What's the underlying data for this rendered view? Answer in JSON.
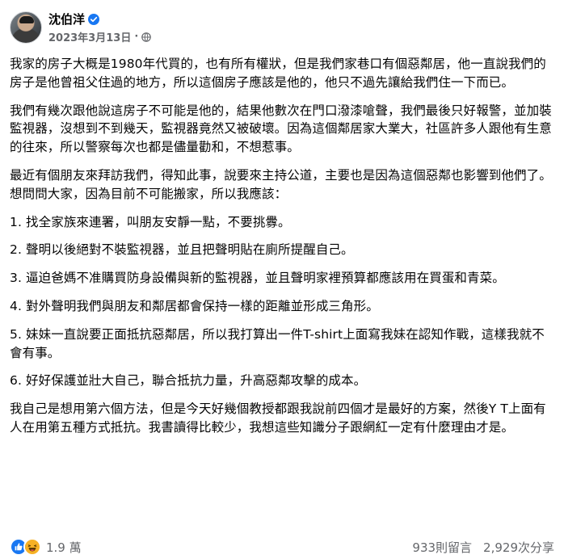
{
  "post": {
    "author": "沈伯洋",
    "date": "2023年3月13日",
    "separator": "·",
    "visibility_icon": "globe-icon",
    "verified_icon": "verified-badge-icon",
    "accent_color": "#1877f2",
    "paragraphs": [
      "我家的房子大概是1980年代買的，也有所有權狀，但是我們家巷口有個惡鄰居，他一直說我們的房子是他曾祖父住過的地方，所以這個房子應該是他的，他只不過先讓給我們住一下而已。",
      "我們有幾次跟他說這房子不可能是他的，結果他數次在門口潑漆嗆聲，我們最後只好報警，並加裝監視器，沒想到不到幾天，監視器竟然又被破壞。因為這個鄰居家大業大，社區許多人跟他有生意的往來，所以警察每次也都是儘量勸和，不想惹事。",
      "最近有個朋友來拜訪我們，得知此事，說要來主持公道，主要也是因為這個惡鄰也影響到他們了。想問問大家，因為目前不可能搬家，所以我應該：",
      "1. 找全家族來連署，叫朋友安靜一點，不要挑釁。",
      "2. 聲明以後絕對不裝監視器，並且把聲明貼在廁所提醒自己。",
      "3. 逼迫爸媽不准購買防身設備與新的監視器，並且聲明家裡預算都應該用在買蛋和青菜。",
      "4. 對外聲明我們與朋友和鄰居都會保持一樣的距離並形成三角形。",
      "5. 妹妹一直說要正面抵抗惡鄰居，所以我打算出一件T-shirt上面寫我妹在認知作戰，這樣我就不會有事。",
      "6. 好好保護並壯大自己，聯合抵抗力量，升高惡鄰攻擊的成本。",
      "我自己是想用第六個方法，但是今天好幾個教授都跟我說前四個才是最好的方案，然後Y T上面有人在用第五種方式抵抗。我書讀得比較少，我想這些知識分子跟網紅一定有什麼理由才是。"
    ]
  },
  "footer": {
    "reaction_icons": [
      "like-icon",
      "haha-icon"
    ],
    "reaction_count": "1.9 萬",
    "comments": "933則留言",
    "shares": "2,929次分享"
  }
}
